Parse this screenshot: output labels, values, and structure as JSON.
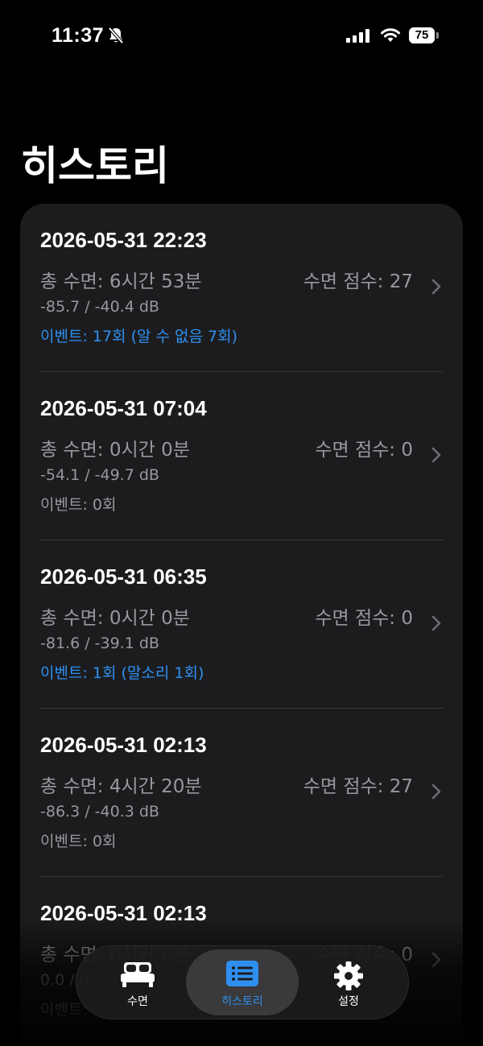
{
  "status_bar": {
    "time": "11:37",
    "battery": "75"
  },
  "page": {
    "title": "히스토리"
  },
  "history": [
    {
      "date": "2026-05-31 22:23",
      "duration": "총 수면: 6시간 53분",
      "score": "수면 점수: 27",
      "db": "-85.7 / -40.4 dB",
      "events": "이벤트: 17회 (알 수 없음 7회)",
      "events_highlight": true
    },
    {
      "date": "2026-05-31 07:04",
      "duration": "총 수면: 0시간 0분",
      "score": "수면 점수: 0",
      "db": "-54.1 / -49.7 dB",
      "events": "이벤트: 0회",
      "events_highlight": false
    },
    {
      "date": "2026-05-31 06:35",
      "duration": "총 수면: 0시간 0분",
      "score": "수면 점수: 0",
      "db": "-81.6 / -39.1 dB",
      "events": "이벤트: 1회 (말소리 1회)",
      "events_highlight": true
    },
    {
      "date": "2026-05-31 02:13",
      "duration": "총 수면: 4시간 20분",
      "score": "수면 점수: 27",
      "db": "-86.3 / -40.3 dB",
      "events": "이벤트: 0회",
      "events_highlight": false
    },
    {
      "date": "2026-05-31 02:13",
      "duration": "총 수면: 0시간 0분",
      "score": "수면 점수: 0",
      "db": "0.0 / 0.0 dB",
      "events": "이벤트: 0회",
      "events_highlight": false
    }
  ],
  "tab_bar": {
    "tabs": [
      {
        "label": "수면",
        "icon": "bed-icon",
        "active": false
      },
      {
        "label": "히스토리",
        "icon": "list-icon",
        "active": true
      },
      {
        "label": "설정",
        "icon": "gear-icon",
        "active": false
      }
    ]
  },
  "colors": {
    "accent": "#2f8ff0",
    "card": "#1c1c1e",
    "secondary_text": "#98989d"
  }
}
